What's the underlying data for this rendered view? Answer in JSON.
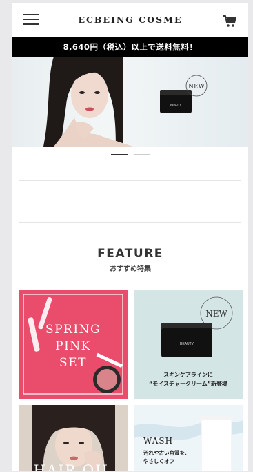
{
  "header": {
    "logo": "ECBEING COSME"
  },
  "promo_bar": {
    "text": "8,640円（税込）以上で送料無料！"
  },
  "hero": {
    "badge": "NEW",
    "product_label": "BEAUTY"
  },
  "carousel": {
    "slide_count": 2,
    "active_index": 0
  },
  "feature": {
    "title": "FEATURE",
    "subtitle": "おすすめ特集",
    "tiles": [
      {
        "lines": [
          "SPRING",
          "PINK",
          "SET"
        ]
      },
      {
        "badge": "NEW",
        "product_label": "BEAUTY",
        "caption": [
          "スキンケアラインに",
          "“モイスチャークリーム”新登場"
        ]
      },
      {
        "title": "HAIR OIL"
      },
      {
        "title": "WASH",
        "body": [
          "汚れや古い角質を、",
          "やさしくオフ"
        ]
      }
    ]
  },
  "colors": {
    "promo_bg": "#000000",
    "spring_tile_bg": "#ea4d6c",
    "new_tile_bg": "#d4e5e6"
  },
  "icons": {
    "menu": "hamburger-menu-icon",
    "cart": "cart-icon"
  }
}
